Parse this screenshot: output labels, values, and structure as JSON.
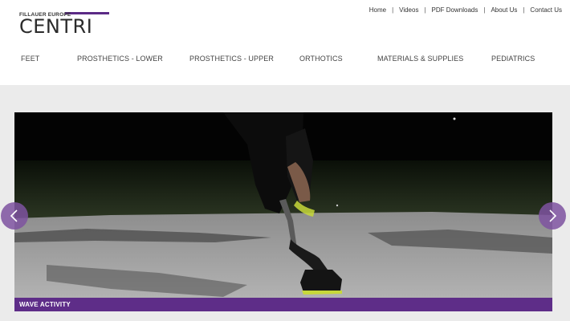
{
  "logo": {
    "top_text": "FILLAUER EUROPE",
    "main_text": "CENTRI"
  },
  "util_nav": {
    "items": [
      "Home",
      "Videos",
      "PDF Downloads",
      "About Us",
      "Contact Us"
    ],
    "separator": "|"
  },
  "main_nav": {
    "items": [
      "FEET",
      "PROSTHETICS - LOWER",
      "PROSTHETICS - UPPER",
      "ORTHOTICS",
      "MATERIALS & SUPPLIES",
      "PEDIATRICS"
    ]
  },
  "slider": {
    "caption": "WAVE ACTIVITY",
    "prev_icon": "chevron-left-icon",
    "next_icon": "chevron-right-icon"
  },
  "colors": {
    "brand_purple": "#5e2d88",
    "arrow_purple": "#7e52a0",
    "page_background": "#ebebeb"
  }
}
